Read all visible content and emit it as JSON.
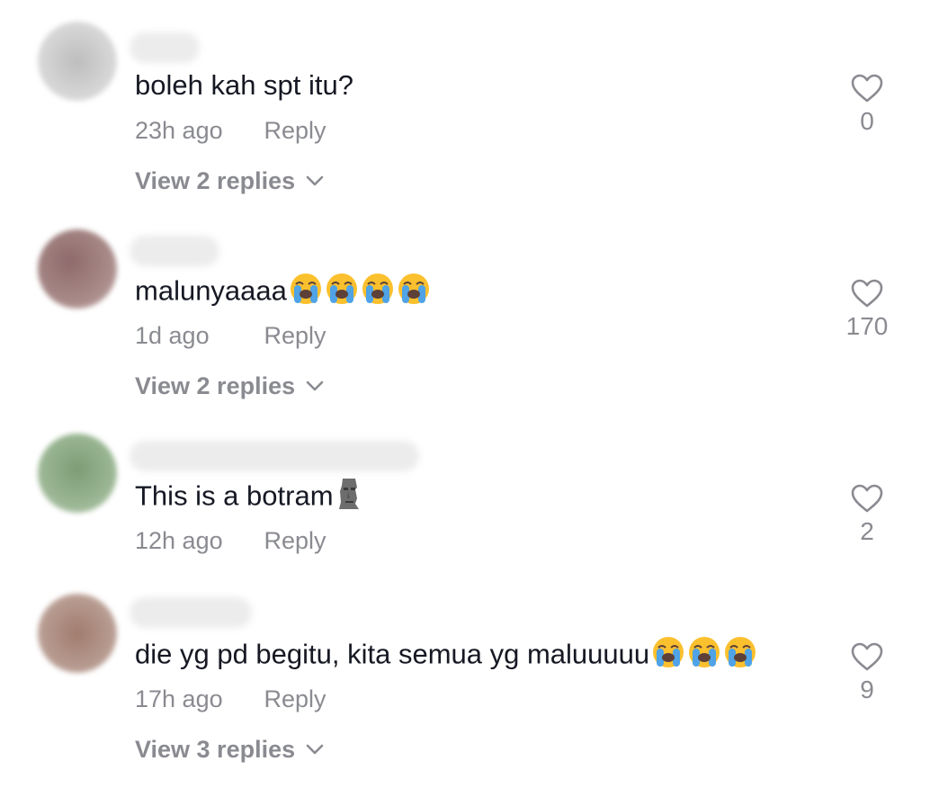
{
  "comments": [
    {
      "text": "boleh kah spt itu?",
      "emojis": [],
      "time": "23h ago",
      "reply_label": "Reply",
      "likes": "0",
      "view_replies": "View 2 replies",
      "avatar_color": "#c9c9c9"
    },
    {
      "text": "malunyaaaa",
      "emojis": [
        "loudly-crying-face-icon",
        "loudly-crying-face-icon",
        "loudly-crying-face-icon",
        "loudly-crying-face-icon"
      ],
      "time": "1d ago",
      "reply_label": "Reply",
      "likes": "170",
      "view_replies": "View 2 replies",
      "avatar_color": "#9a7b7a"
    },
    {
      "text": "This is a botram",
      "emojis": [
        "moai-icon"
      ],
      "time": "12h ago",
      "reply_label": "Reply",
      "likes": "2",
      "view_replies": "",
      "avatar_color": "#8aa585"
    },
    {
      "text": "die yg pd begitu, kita semua yg maluuuuu",
      "emojis": [
        "loudly-crying-face-icon",
        "loudly-crying-face-icon",
        "loudly-crying-face-icon"
      ],
      "time": "17h ago",
      "reply_label": "Reply",
      "likes": "9",
      "view_replies": "View 3 replies",
      "avatar_color": "#a2877d"
    }
  ],
  "colors": {
    "text": "#161823",
    "muted": "#8a8b91",
    "emoji_face": "#fbc02d",
    "emoji_tears": "#4fa3e6"
  }
}
